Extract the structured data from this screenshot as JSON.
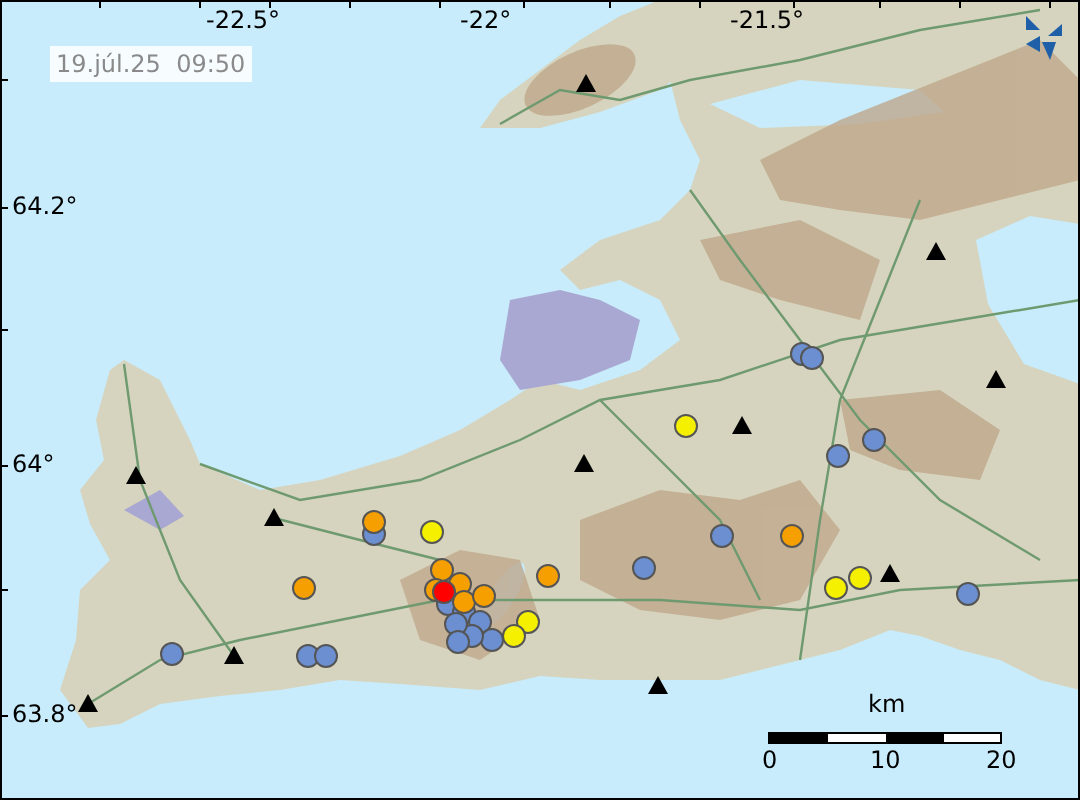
{
  "timestamp": "19.júl.25  09:50",
  "longitude_labels": [
    "-22.5°",
    "-22°",
    "-21.5°"
  ],
  "latitude_labels": [
    "64.2°",
    "64°",
    "63.8°"
  ],
  "scale": {
    "unit": "km",
    "labels": [
      "0",
      "10",
      "20"
    ]
  },
  "earthquakes": [
    {
      "color": "#6b8fd0"
    },
    {
      "color": "#6b8fd0"
    },
    {
      "color": "#6b8fd0"
    },
    {
      "color": "#6b8fd0"
    },
    {
      "color": "#6b8fd0"
    },
    {
      "color": "#6b8fd0"
    },
    {
      "color": "#6b8fd0"
    },
    {
      "color": "#6b8fd0"
    },
    {
      "color": "#6b8fd0"
    },
    {
      "color": "#6b8fd0"
    },
    {
      "color": "#6b8fd0"
    },
    {
      "color": "#6b8fd0"
    },
    {
      "color": "#6b8fd0"
    },
    {
      "color": "#6b8fd0"
    },
    {
      "color": "#6b8fd0"
    },
    {
      "color": "#6b8fd0"
    },
    {
      "color": "#6b8fd0"
    },
    {
      "color": "#6b8fd0"
    },
    {
      "color": "#f5a000"
    },
    {
      "color": "#f5a000"
    },
    {
      "color": "#f5a000"
    },
    {
      "color": "#f5a000"
    },
    {
      "color": "#f5a000"
    },
    {
      "color": "#f5a000"
    },
    {
      "color": "#f5a000"
    },
    {
      "color": "#f5a000"
    },
    {
      "color": "#f5a000"
    },
    {
      "color": "#f5f000"
    },
    {
      "color": "#f5f000"
    },
    {
      "color": "#f5f000"
    },
    {
      "color": "#f5f000"
    },
    {
      "color": "#f5f000"
    },
    {
      "color": "#f5f000"
    },
    {
      "color": "#ff0000"
    }
  ]
}
